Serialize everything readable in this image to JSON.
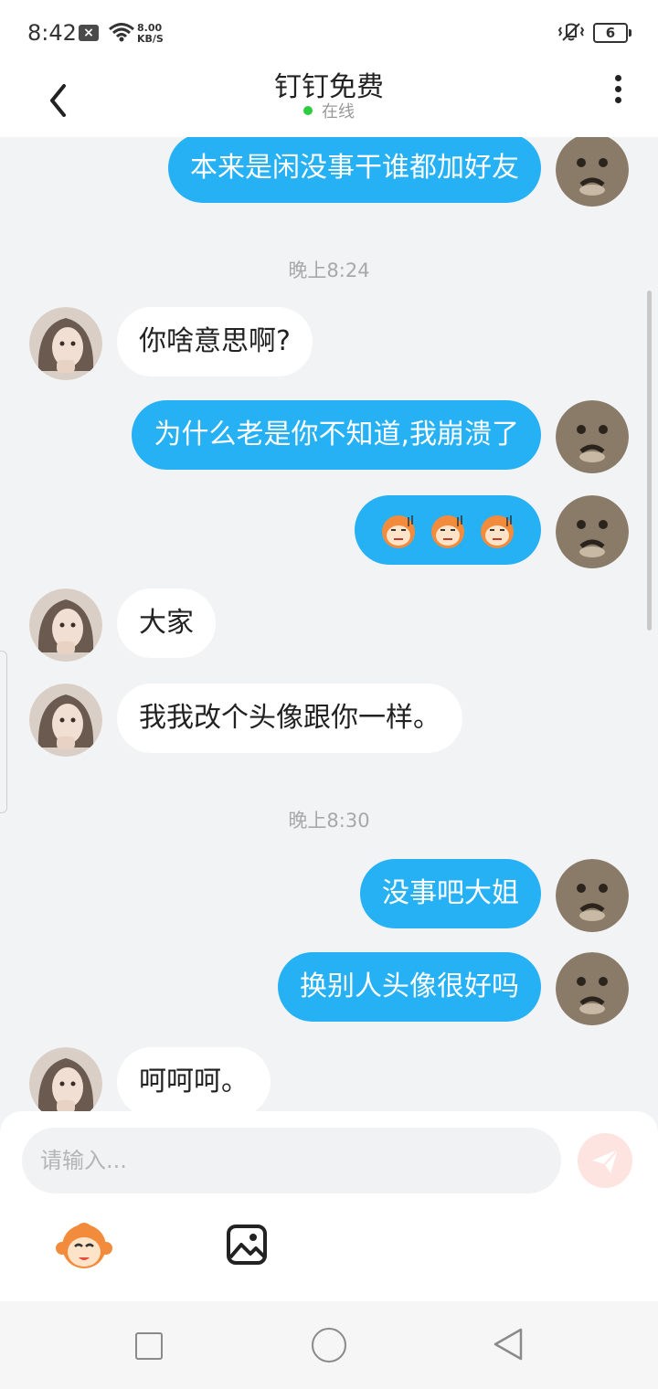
{
  "status_bar": {
    "time": "8:42",
    "net_speed_value": "8.00",
    "net_speed_unit": "KB/S",
    "battery": "6"
  },
  "header": {
    "title": "钉钉免费",
    "status": "在线",
    "status_color": "#2ecc40"
  },
  "messages": [
    {
      "dir": "out",
      "text": "本来是闲没事干谁都加好友"
    },
    {
      "time": "晚上8:24"
    },
    {
      "dir": "in",
      "text": "你啥意思啊?"
    },
    {
      "dir": "out",
      "text": "为什么老是你不知道,我崩溃了"
    },
    {
      "dir": "out",
      "stickers": [
        "monkey-face-icon",
        "monkey-face-icon",
        "monkey-face-icon"
      ]
    },
    {
      "dir": "in",
      "text": "大家"
    },
    {
      "dir": "in",
      "text": "我我改个头像跟你一样。"
    },
    {
      "time": "晚上8:30"
    },
    {
      "dir": "out",
      "text": "没事吧大姐"
    },
    {
      "dir": "out",
      "text": "换别人头像很好吗"
    },
    {
      "dir": "in",
      "text": "呵呵呵。"
    }
  ],
  "composer": {
    "placeholder": "请输入..."
  },
  "colors": {
    "outgoing_bubble": "#27b1f5",
    "incoming_bubble": "#ffffff",
    "background": "#f2f3f5"
  }
}
